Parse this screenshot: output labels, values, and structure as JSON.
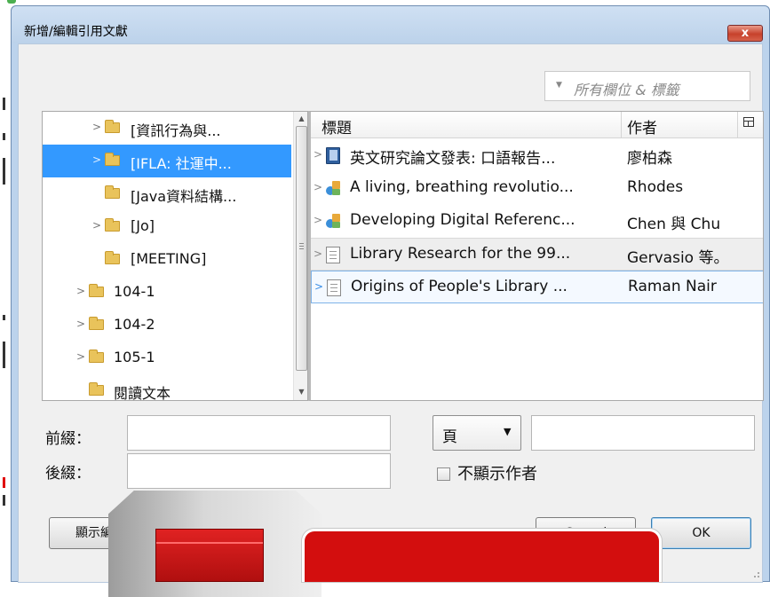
{
  "window": {
    "title": "新增/編輯引用文獻",
    "close_label": "x"
  },
  "filter": {
    "placeholder": "所有欄位 & 標籤",
    "menu_arrow": "▼"
  },
  "tree": {
    "items": [
      {
        "label": "[資訊行為與...",
        "expandable": true,
        "selected": false
      },
      {
        "label": "[IFLA: 社運中...",
        "expandable": true,
        "selected": true
      },
      {
        "label": "[Java資料結構...",
        "expandable": false,
        "selected": false
      },
      {
        "label": "[Jo]",
        "expandable": true,
        "selected": false
      },
      {
        "label": "[MEETING]",
        "expandable": false,
        "selected": false
      },
      {
        "label": "104-1",
        "expandable": true,
        "selected": false
      },
      {
        "label": "104-2",
        "expandable": true,
        "selected": false
      },
      {
        "label": "105-1",
        "expandable": true,
        "selected": false
      },
      {
        "label": "閱讀文本",
        "expandable": false,
        "selected": false
      }
    ]
  },
  "list": {
    "columns": {
      "title": "標題",
      "author": "作者"
    },
    "rows": [
      {
        "title": "英文研究論文發表: 口語報告...",
        "author": "廖柏森",
        "icon": "book-icon",
        "state": "normal"
      },
      {
        "title": "A living, breathing revolutio...",
        "author": "Rhodes",
        "icon": "webpage-icon",
        "state": "normal"
      },
      {
        "title": "Developing Digital Referenc...",
        "author": "Chen 與 Chu",
        "icon": "webpage-icon",
        "state": "normal"
      },
      {
        "title": "Library Research for the 99...",
        "author": "Gervasio 等。",
        "icon": "document-icon",
        "state": "hover"
      },
      {
        "title": "Origins of People's Library ...",
        "author": "Raman Nair",
        "icon": "document-icon",
        "state": "current"
      }
    ]
  },
  "locator": {
    "prefix_label": "前綴：",
    "suffix_label": "後綴：",
    "prefix_value": "",
    "suffix_value": "",
    "locator_type": "頁",
    "locator_value": "",
    "suppress_author_label": "不顯示作者",
    "suppress_author_checked": false
  },
  "buttons": {
    "show_editor": "顯示編輯器",
    "cancel": "Cancel",
    "ok": "OK"
  },
  "colors": {
    "selection": "#3399ff",
    "overlay_red": "#d30e0e"
  }
}
